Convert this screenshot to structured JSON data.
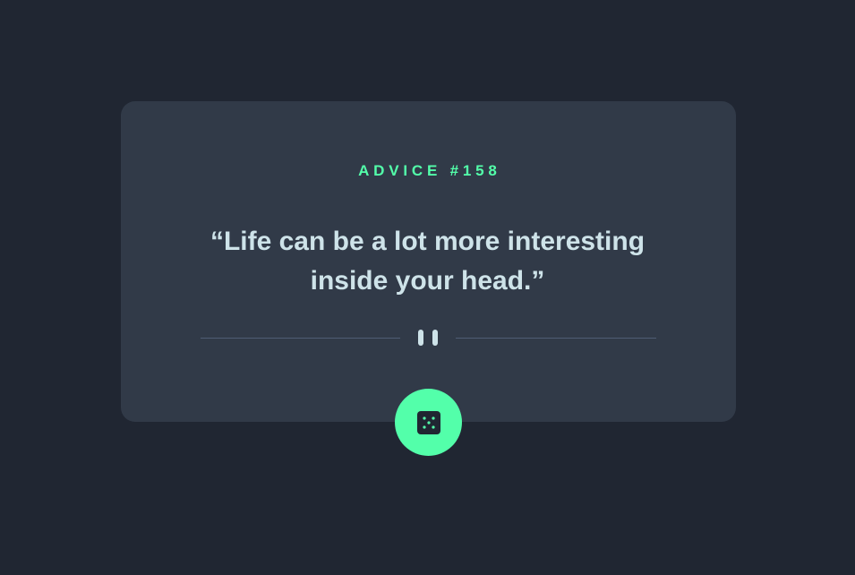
{
  "advice": {
    "id_label": "ADVICE #158",
    "text": "“Life can be a lot more interesting inside your head.”"
  },
  "icons": {
    "divider": "pause-icon",
    "button": "dice-icon"
  },
  "colors": {
    "background": "#202632",
    "card": "#313a48",
    "accent": "#53ffaa",
    "text": "#cee3e9",
    "divider": "#4f5d74"
  }
}
